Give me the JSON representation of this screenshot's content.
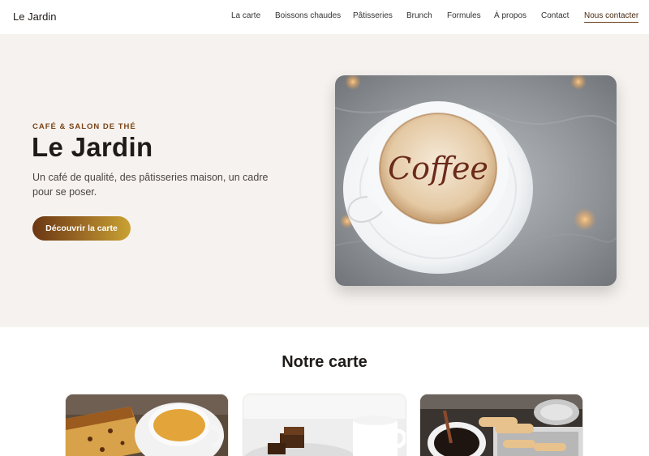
{
  "header": {
    "brand": "Le Jardin",
    "nav": [
      {
        "label": "La carte"
      },
      {
        "label": "Boissons chaudes"
      },
      {
        "label": "Pâtisseries"
      },
      {
        "label": "Brunch"
      },
      {
        "label": "Formules"
      },
      {
        "label": "À propos"
      },
      {
        "label": "Contact"
      },
      {
        "label": "Nous contacter"
      }
    ]
  },
  "hero": {
    "eyebrow": "CAFÉ & SALON DE THÉ",
    "title": "Le Jardin",
    "description": "Un café de qualité, des pâtisseries maison, un cadre pour se poser.",
    "button_label": "Découvrir la carte",
    "photo_text": "Coffee"
  },
  "menu_section": {
    "title": "Notre carte"
  },
  "colors": {
    "accent": "#6b3d17",
    "hero_bg": "#f6f2ef",
    "button_gradient_start": "#6a3713",
    "button_gradient_end": "#c9a232"
  }
}
